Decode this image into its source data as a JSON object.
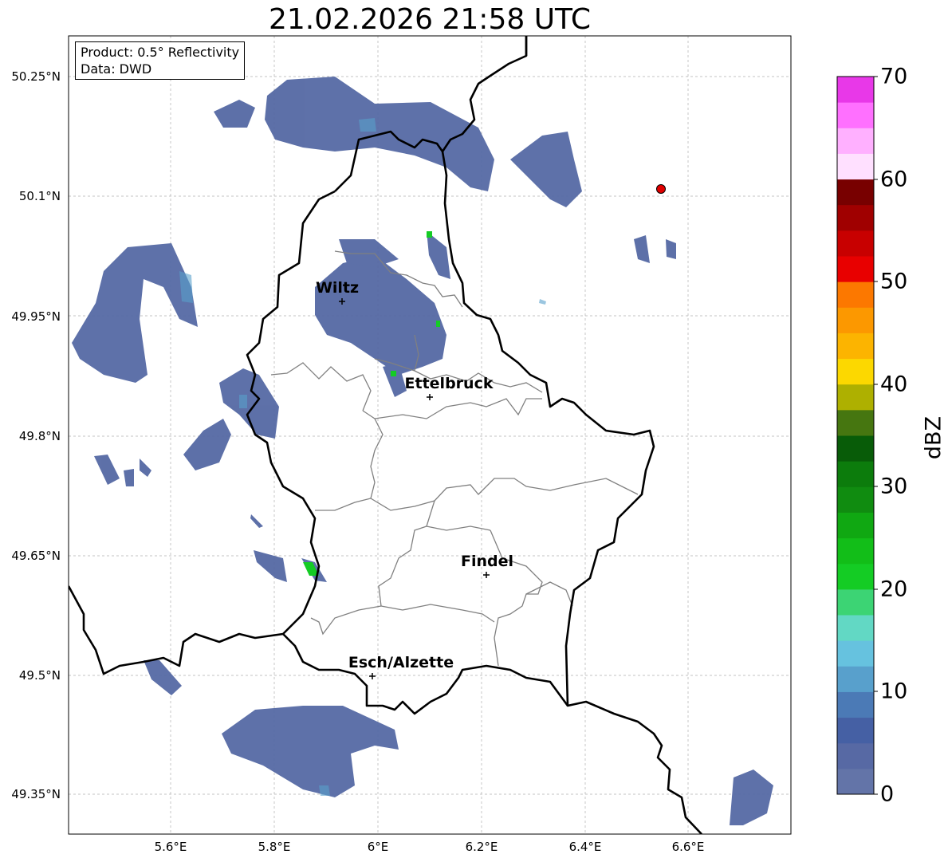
{
  "title": "21.02.2026 21:58 UTC",
  "info": {
    "product": "Product: 0.5° Reflectivity",
    "data": "Data: DWD"
  },
  "axes": {
    "lon_ticks": [
      "5.6°E",
      "5.8°E",
      "6°E",
      "6.2°E",
      "6.4°E",
      "6.6°E"
    ],
    "lat_ticks": [
      "50.25°N",
      "50.1°N",
      "49.95°N",
      "49.8°N",
      "49.65°N",
      "49.5°N",
      "49.35°N"
    ],
    "lon_range": [
      5.4,
      6.79
    ],
    "lat_range": [
      49.3,
      50.3
    ]
  },
  "cities": [
    {
      "name": "Wiltz",
      "lon": 5.93,
      "lat": 49.97
    },
    {
      "name": "Ettelbruck",
      "lon": 6.1,
      "lat": 49.85
    },
    {
      "name": "Findel",
      "lon": 6.21,
      "lat": 49.63
    },
    {
      "name": "Esch/Alzette",
      "lon": 5.99,
      "lat": 49.5
    }
  ],
  "radar_site": {
    "lon": 6.55,
    "lat": 50.11,
    "color": "#e00000"
  },
  "colorbar": {
    "title": "dBZ",
    "ticks": [
      "0",
      "10",
      "20",
      "30",
      "40",
      "50",
      "60",
      "70"
    ],
    "range": [
      0,
      70
    ],
    "colors": [
      "#6374a8",
      "#5769a4",
      "#4560a4",
      "#4b7ab6",
      "#58a0cc",
      "#66c2df",
      "#62d8c4",
      "#3cd474",
      "#14cc24",
      "#12be18",
      "#10a812",
      "#108c10",
      "#0c7c0c",
      "#085c08",
      "#467610",
      "#aeb000",
      "#fcd800",
      "#fcb400",
      "#fc9800",
      "#fc7800",
      "#e80000",
      "#c80000",
      "#a00000",
      "#780000",
      "#ffe0ff",
      "#ffb0ff",
      "#ff70ff",
      "#e838e8"
    ]
  }
}
